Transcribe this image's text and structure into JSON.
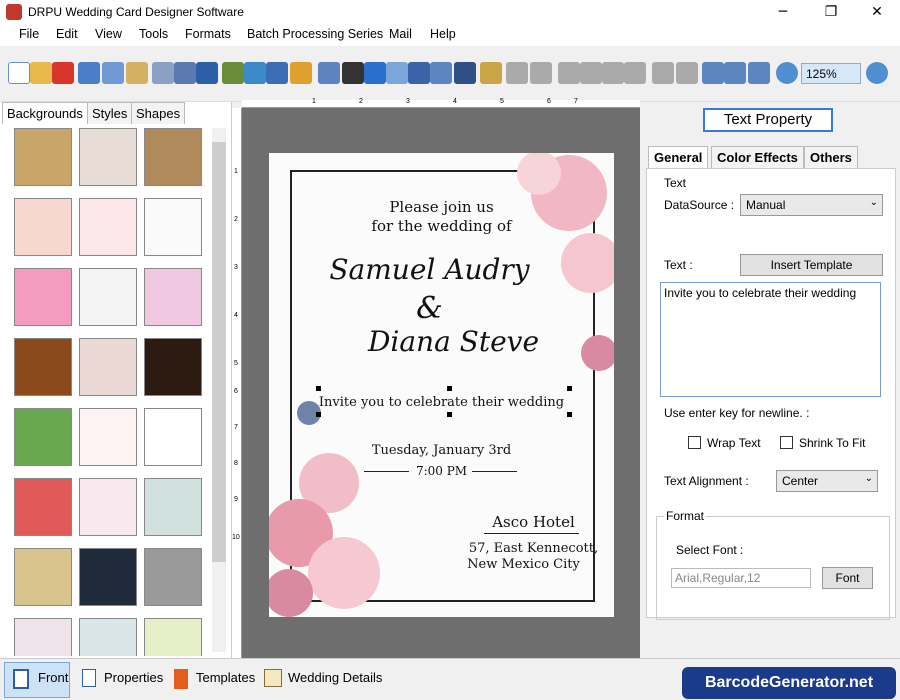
{
  "window": {
    "title": "DRPU Wedding Card Designer Software",
    "min": "─",
    "max": "❐",
    "close": "✕"
  },
  "menu": [
    "File",
    "Edit",
    "View",
    "Tools",
    "Formats",
    "Batch Processing Series",
    "Mail",
    "Help"
  ],
  "toolbar": {
    "zoom": "125%"
  },
  "left_tabs": [
    "Backgrounds",
    "Styles",
    "Shapes"
  ],
  "ruler_numbers": [
    "1",
    "2",
    "3",
    "4",
    "5",
    "6",
    "7"
  ],
  "ruler_left_numbers": [
    "1",
    "2",
    "3",
    "4",
    "5",
    "6",
    "7",
    "8",
    "9",
    "10"
  ],
  "card": {
    "line1": "Please join us",
    "line2": "for the wedding of",
    "name1": "Samuel Audry",
    "amp": "&",
    "name2": "Diana Steve",
    "invite": "Invite you to celebrate their wedding",
    "date": "Tuesday, January 3rd",
    "time": "7:00 PM",
    "venue": "Asco Hotel",
    "addr1": "57, East Kennecott,",
    "addr2": "New Mexico City"
  },
  "right": {
    "header_btn": "Text Property",
    "tabs": [
      "General",
      "Color Effects",
      "Others"
    ],
    "group_text": "Text",
    "datasource_label": "DataSource :",
    "datasource_value": "Manual",
    "text_label": "Text :",
    "insert_template": "Insert Template",
    "text_value": "Invite you to celebrate their wedding",
    "newline_hint": "Use enter key for newline. :",
    "wrap_text": "Wrap Text",
    "shrink_fit": "Shrink To Fit",
    "align_label": "Text Alignment :",
    "align_value": "Center",
    "group_format": "Format",
    "select_font_label": "Select Font :",
    "font_value": "Arial,Regular,12",
    "font_btn": "Font"
  },
  "bottom": [
    "Front",
    "Properties",
    "Templates",
    "Wedding Details"
  ],
  "brand": "BarcodeGenerator.net"
}
